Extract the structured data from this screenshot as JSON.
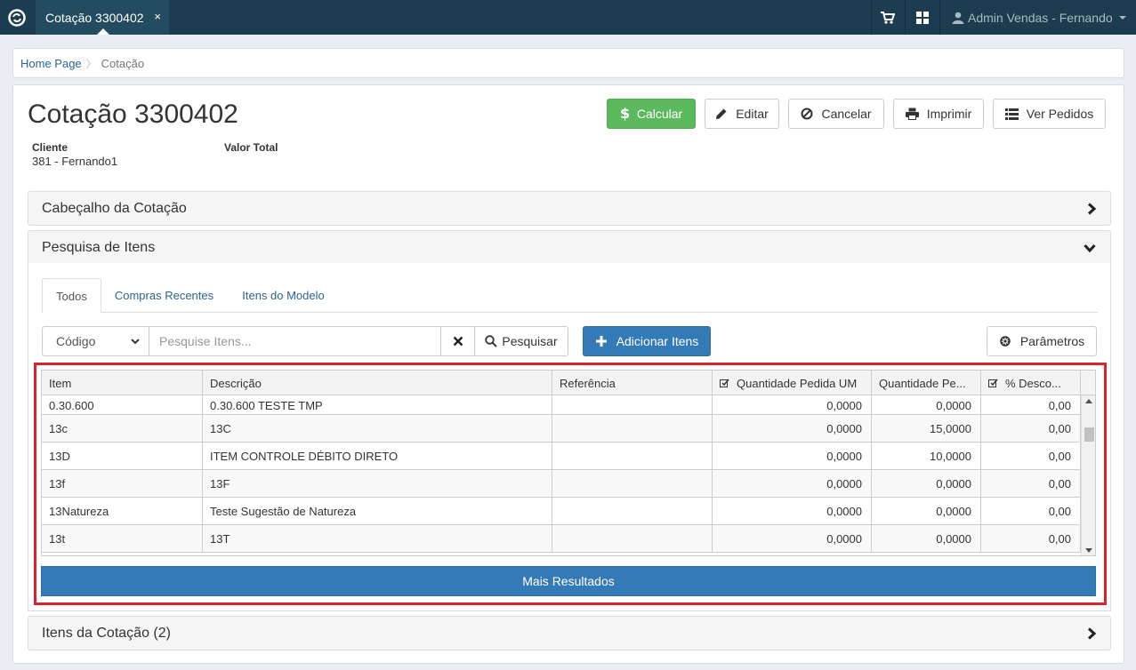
{
  "topbar": {
    "tab_title": "Cotação 3300402",
    "tab_close": "×",
    "user_name": "Admin Vendas - Fernando"
  },
  "breadcrumb": {
    "home": "Home Page",
    "current": "Cotação"
  },
  "page": {
    "title": "Cotação 3300402",
    "buttons": {
      "calcular": "Calcular",
      "editar": "Editar",
      "cancelar": "Cancelar",
      "imprimir": "Imprimir",
      "ver_pedidos": "Ver Pedidos"
    },
    "cliente_label": "Cliente",
    "cliente_value": "381 - Fernando1",
    "valor_total_label": "Valor Total"
  },
  "sections": {
    "cabecalho": "Cabeçalho da Cotação",
    "pesquisa": "Pesquisa de Itens",
    "itens_cotacao": "Itens da Cotação (2)"
  },
  "search": {
    "tabs": [
      "Todos",
      "Compras Recentes",
      "Itens do Modelo"
    ],
    "active_tab": "Todos",
    "filter_value": "Código",
    "placeholder": "Pesquise Itens...",
    "search_label": "Pesquisar",
    "add_label": "Adicionar Itens",
    "params_label": "Parâmetros"
  },
  "grid": {
    "columns": [
      "Item",
      "Descrição",
      "Referência",
      "Quantidade Pedida UM",
      "Quantidade Pe...",
      "% Desco..."
    ],
    "rows": [
      [
        "0.30.600",
        "0.30.600 TESTE TMP",
        "",
        "0,0000",
        "0,0000",
        "0,00"
      ],
      [
        "13c",
        "13C",
        "",
        "0,0000",
        "15,0000",
        "0,00"
      ],
      [
        "13D",
        "ITEM CONTROLE DÉBITO DIRETO",
        "",
        "0,0000",
        "10,0000",
        "0,00"
      ],
      [
        "13f",
        "13F",
        "",
        "0,0000",
        "0,0000",
        "0,00"
      ],
      [
        "13Natureza",
        "Teste Sugestão de Natureza",
        "",
        "0,0000",
        "0,0000",
        "0,00"
      ],
      [
        "13t",
        "13T",
        "",
        "0,0000",
        "0,0000",
        "0,00"
      ]
    ],
    "more_results": "Mais Resultados"
  },
  "colors": {
    "topbar": "#1c3d4f",
    "success": "#5cb85c",
    "primary": "#337ab7",
    "highlight": "#d9232d"
  }
}
